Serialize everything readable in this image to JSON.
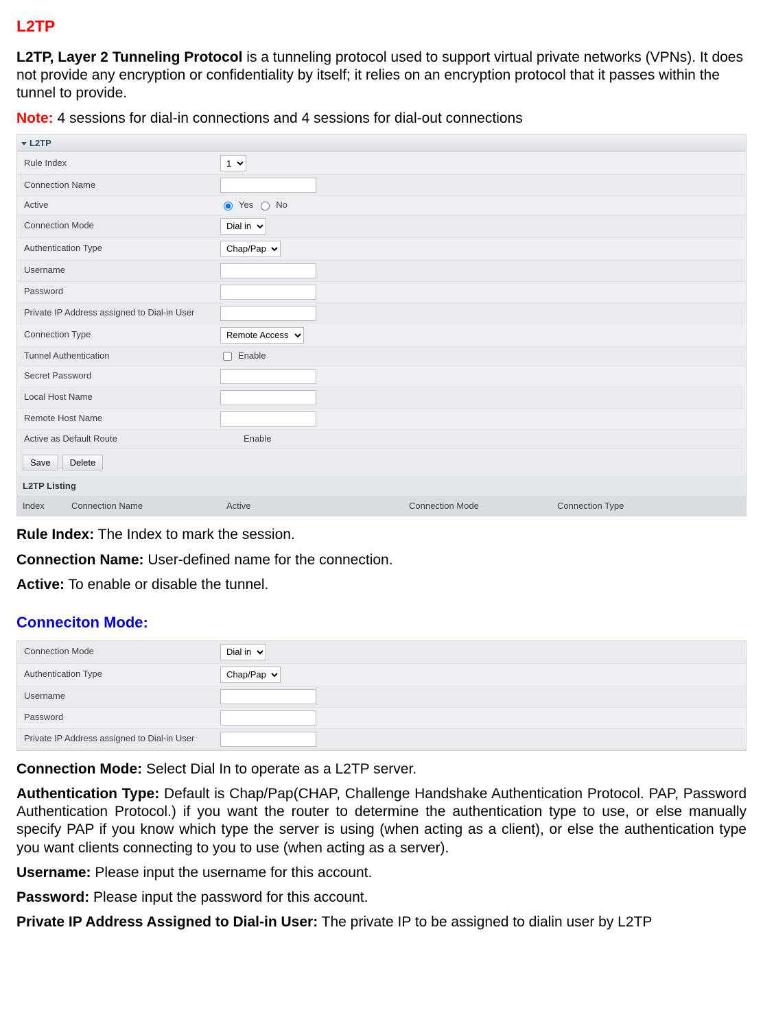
{
  "heading": "L2TP",
  "intro": {
    "bold": "L2TP, Layer 2 Tunneling Protocol",
    "text": " is a tunneling protocol used to support virtual private networks (VPNs). It does not provide any encryption or confidentiality by itself; it relies on an encryption protocol that it passes within the tunnel to provide."
  },
  "note": {
    "label": "Note:",
    "text": " 4 sessions for dial-in connections and 4 sessions for dial-out connections"
  },
  "panel1": {
    "title": "L2TP",
    "rows": {
      "rule_index": "Rule Index",
      "rule_index_val": "1",
      "conn_name": "Connection Name",
      "active": "Active",
      "active_yes": "Yes",
      "active_no": "No",
      "conn_mode": "Connection Mode",
      "conn_mode_val": "Dial in",
      "auth_type": "Authentication Type",
      "auth_type_val": "Chap/Pap",
      "username": "Username",
      "password": "Password",
      "priv_ip": "Private IP Address assigned to Dial-in User",
      "conn_type": "Connection Type",
      "conn_type_val": "Remote Access",
      "tunnel_auth": "Tunnel Authentication",
      "enable": "Enable",
      "secret": "Secret Password",
      "local_host": "Local Host Name",
      "remote_host": "Remote Host Name",
      "def_route": "Active as Default Route"
    },
    "buttons": {
      "save": "Save",
      "delete": "Delete"
    },
    "listing_title": "L2TP Listing",
    "listing_head": {
      "index": "Index",
      "name": "Connection Name",
      "active": "Active",
      "mode": "Connection Mode",
      "type": "Connection Type"
    }
  },
  "desc": {
    "rule_index": {
      "b": "Rule Index:",
      "t": " The Index to mark the session."
    },
    "conn_name": {
      "b": "Connection Name:",
      "t": " User-defined name for the connection."
    },
    "active": {
      "b": "Active:",
      "t": " To enable or disable the tunnel."
    }
  },
  "heading2": "Conneciton Mode:",
  "panel2": {
    "rows": {
      "conn_mode": "Connection Mode",
      "conn_mode_val": "Dial in",
      "auth_type": "Authentication Type",
      "auth_type_val": "Chap/Pap",
      "username": "Username",
      "password": "Password",
      "priv_ip": "Private IP Address assigned to Dial-in User"
    }
  },
  "desc2": {
    "conn_mode": {
      "b": "Connection Mode:",
      "t": " Select Dial In to operate as a L2TP server."
    },
    "auth_type": {
      "b": "Authentication Type:",
      "t": " Default is Chap/Pap(CHAP, Challenge Handshake Authentication Protocol. PAP, Password Authentication Protocol.) if you want the router to determine the authentication type to use, or else manually specify PAP if you know which type the server is using (when acting as a client), or else the authentication type you want clients connecting to you to use (when acting as a server)."
    },
    "username": {
      "b": "Username:",
      "t": " Please input the username for this account."
    },
    "password": {
      "b": "Password:",
      "t": " Please input the password for this account."
    },
    "priv_ip": {
      "b": "Private IP Address Assigned to Dial-in User:",
      "t": " The private IP to be assigned to dialin user by L2TP"
    }
  }
}
